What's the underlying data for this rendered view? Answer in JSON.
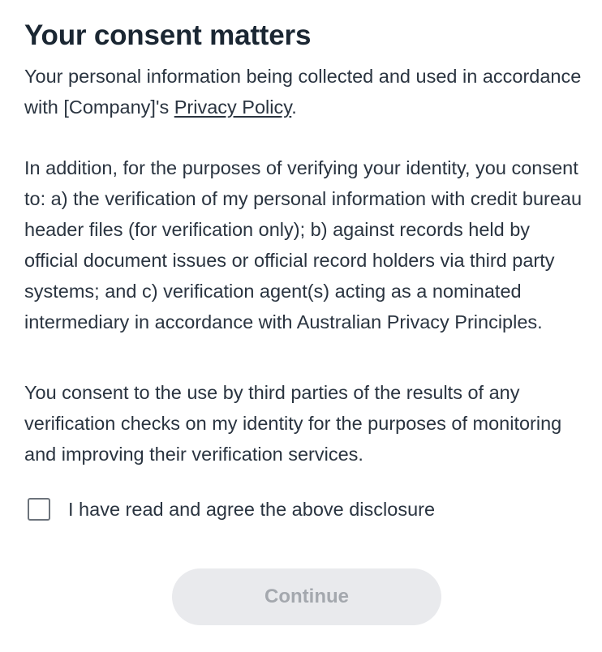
{
  "consent": {
    "title": "Your consent matters",
    "p1_text": "Your personal information being collected and used in accordance with [Company]'s ",
    "p1_link": "Privacy Policy",
    "p1_end": ".",
    "p2": "In addition, for the purposes of verifying your identity, you consent to: a) the verification of my personal information with credit bureau header files (for verification only); b) against records held by official document issues or official record holders via third party systems; and c) verification agent(s) acting as a nominated intermediary in accordance with Australian Privacy Principles.",
    "p3": "You consent to the use by third parties of the results of any verification checks on my identity for the purposes of monitoring and improving their verification services.",
    "agree_label": "I have read and agree the above disclosure",
    "agree_checked": false,
    "continue_label": "Continue",
    "continue_enabled": false
  },
  "colors": {
    "text": "#2a3440",
    "title": "#1b2733",
    "button_disabled_bg": "#e9eaed",
    "button_disabled_text": "#a4a8ae",
    "checkbox_border": "#6c737b"
  }
}
